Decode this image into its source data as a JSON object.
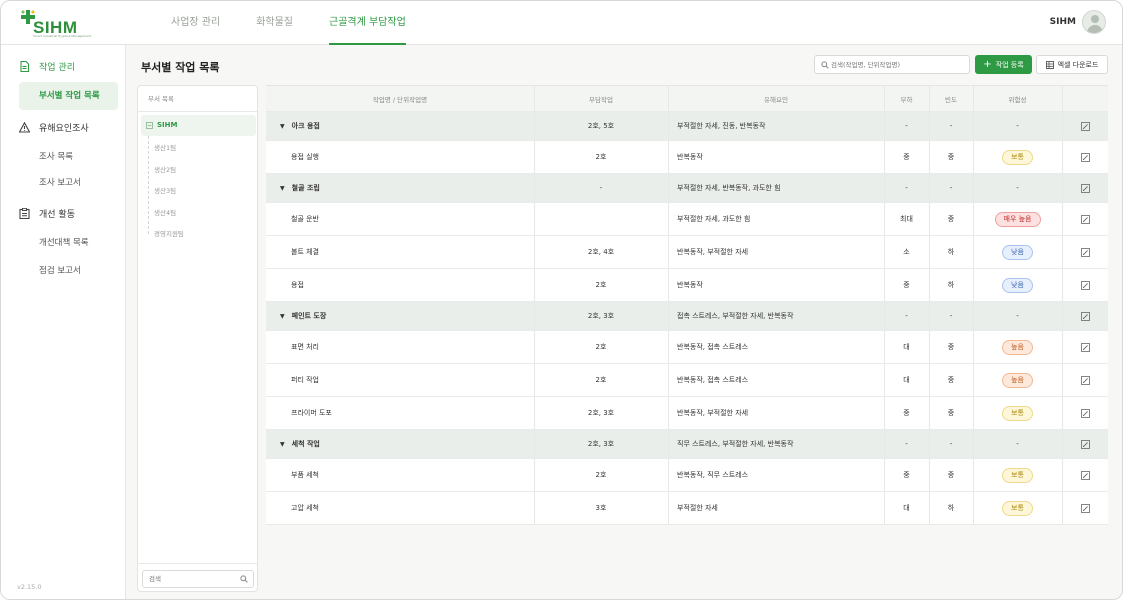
{
  "app": {
    "logo": "SIHM",
    "logo_tagline": "Smart Industrial Hygiene Management",
    "version": "v2.15.0"
  },
  "header": {
    "nav": [
      {
        "label": "사업장 관리",
        "active": false
      },
      {
        "label": "화학물질",
        "active": false
      },
      {
        "label": "근골격계 부담작업",
        "active": true
      }
    ],
    "user": "SIHM"
  },
  "sidebar": {
    "groups": [
      {
        "label": "작업 관리",
        "icon": "document-icon",
        "active": true,
        "items": [
          {
            "label": "부서별 작업 목록",
            "active": true
          }
        ]
      },
      {
        "label": "유해요인조사",
        "icon": "warning-icon",
        "active": false,
        "items": [
          {
            "label": "조사 목록"
          },
          {
            "label": "조사 보고서"
          }
        ]
      },
      {
        "label": "개선 활동",
        "icon": "clipboard-icon",
        "active": false,
        "items": [
          {
            "label": "개선대책 목록"
          },
          {
            "label": "점검 보고서"
          }
        ]
      }
    ]
  },
  "page": {
    "title": "부서별 작업 목록",
    "search_placeholder": "검색(작업명, 단위작업명)",
    "add_button": "작업 등록",
    "excel_button": "엑셀 다운로드"
  },
  "tree": {
    "header": "부서 목록",
    "root": "SIHM",
    "children": [
      "생산1팀",
      "생산2팀",
      "생산3팀",
      "생산4팀",
      "경영지원팀"
    ],
    "search_placeholder": "검색"
  },
  "table": {
    "columns": [
      "작업명 / 단위작업명",
      "부담작업",
      "유해요인",
      "부하",
      "빈도",
      "위험성",
      ""
    ],
    "rows": [
      {
        "type": "group",
        "name": "아크 용접",
        "burden": "2호, 5호",
        "factors": "부적절한 자세, 진동, 반복동작",
        "load": "-",
        "freq": "-",
        "risk": "-"
      },
      {
        "type": "item",
        "name": "용접 실행",
        "burden": "2호",
        "factors": "반복동작",
        "load": "중",
        "freq": "중",
        "risk": "보통",
        "level": "normal"
      },
      {
        "type": "group",
        "name": "철골 조립",
        "burden": "-",
        "factors": "부적절한 자세, 반복동작, 과도한 힘",
        "load": "-",
        "freq": "-",
        "risk": "-"
      },
      {
        "type": "item",
        "name": "철골 운반",
        "burden": "",
        "factors": "부적절한 자세, 과도한 힘",
        "load": "최대",
        "freq": "중",
        "risk": "매우 높음",
        "level": "very-high"
      },
      {
        "type": "item",
        "name": "볼트 체결",
        "burden": "2호, 4호",
        "factors": "반복동작, 부적절한 자세",
        "load": "소",
        "freq": "하",
        "risk": "낮음",
        "level": "low"
      },
      {
        "type": "item",
        "name": "용접",
        "burden": "2호",
        "factors": "반복동작",
        "load": "중",
        "freq": "하",
        "risk": "낮음",
        "level": "low"
      },
      {
        "type": "group",
        "name": "페인트 도장",
        "burden": "2호, 3호",
        "factors": "접촉 스트레스, 부적절한 자세, 반복동작",
        "load": "-",
        "freq": "-",
        "risk": "-"
      },
      {
        "type": "item",
        "name": "표면 처리",
        "burden": "2호",
        "factors": "반복동작, 접촉 스트레스",
        "load": "대",
        "freq": "중",
        "risk": "높음",
        "level": "high"
      },
      {
        "type": "item",
        "name": "퍼티 작업",
        "burden": "2호",
        "factors": "반복동작, 접촉 스트레스",
        "load": "대",
        "freq": "중",
        "risk": "높음",
        "level": "high"
      },
      {
        "type": "item",
        "name": "프라이머 도포",
        "burden": "2호, 3호",
        "factors": "반복동작, 부적절한 자세",
        "load": "중",
        "freq": "중",
        "risk": "보통",
        "level": "normal"
      },
      {
        "type": "group",
        "name": "세척 작업",
        "burden": "2호, 3호",
        "factors": "직무 스트레스, 부적절한 자세, 반복동작",
        "load": "-",
        "freq": "-",
        "risk": "-"
      },
      {
        "type": "item",
        "name": "부품 세척",
        "burden": "2호",
        "factors": "반복동작, 직무 스트레스",
        "load": "중",
        "freq": "중",
        "risk": "보통",
        "level": "normal"
      },
      {
        "type": "item",
        "name": "고압 세척",
        "burden": "3호",
        "factors": "부적절한 자세",
        "load": "대",
        "freq": "하",
        "risk": "보통",
        "level": "normal"
      }
    ]
  },
  "colors": {
    "accent": "#2f9a44",
    "risk_normal_bg": "#fdf6d8",
    "risk_normal_border": "#efd98a",
    "risk_normal_text": "#b08a10",
    "risk_low_bg": "#e6effc",
    "risk_low_border": "#a9c3ec",
    "risk_low_text": "#3b66b0",
    "risk_high_bg": "#fde9dc",
    "risk_high_border": "#f0b894",
    "risk_high_text": "#c25a1e",
    "risk_very_high_bg": "#fde1e1",
    "risk_very_high_border": "#ee9e9e",
    "risk_very_high_text": "#c22f2f"
  }
}
